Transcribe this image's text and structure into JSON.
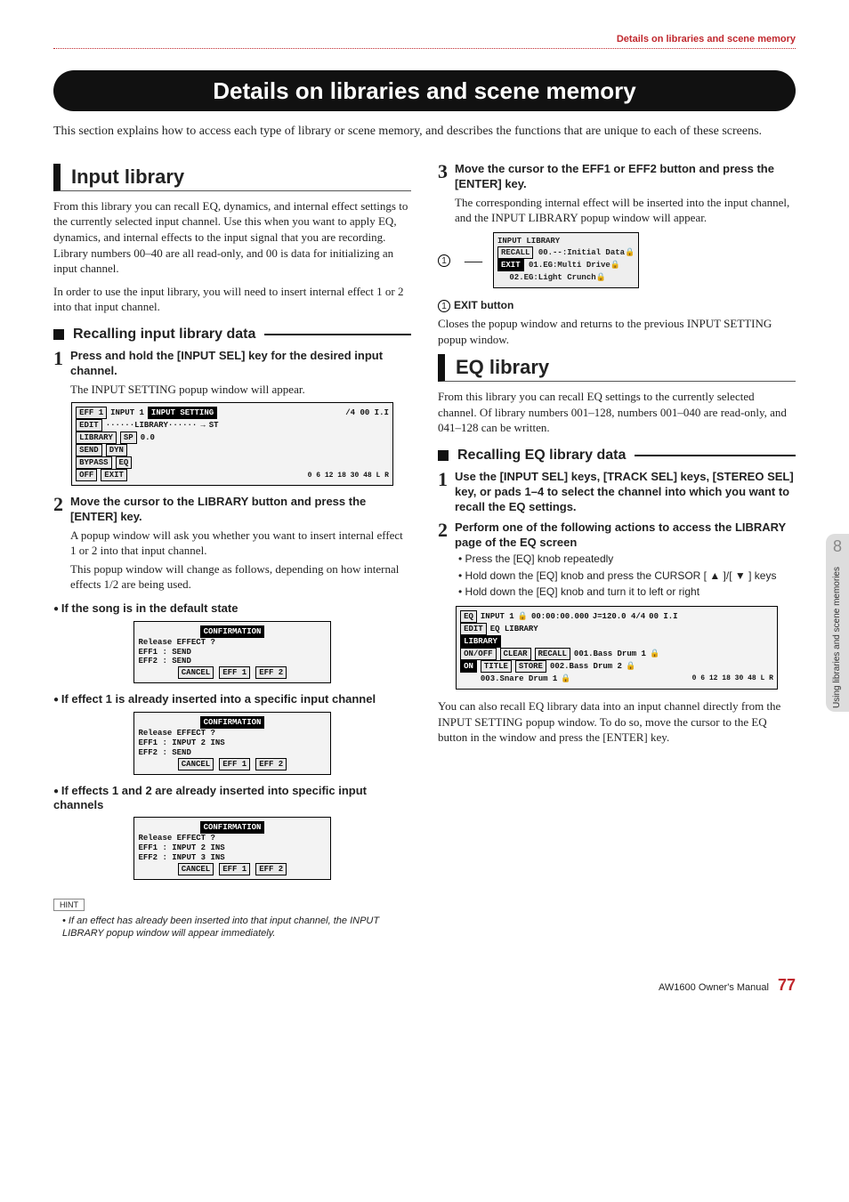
{
  "header_right": "Details on libraries and scene memory",
  "main_title": "Details on libraries and scene memory",
  "intro": "This section explains how to access each type of library or scene memory, and describes the functions that are unique to each of these screens.",
  "side_tab": {
    "chapter": "8",
    "caption": "Using libraries and scene memories"
  },
  "left": {
    "h2": "Input library",
    "p1": "From this library you can recall EQ, dynamics, and internal effect settings to the currently selected input channel. Use this when you want to apply EQ, dynamics, and internal effects to the input signal that you are recording. Library numbers 00–40 are all read-only, and 00 is data for initializing an input channel.",
    "p2": "In order to use the input library, you will need to insert internal effect 1 or 2 into that input channel.",
    "h3": "Recalling input library data",
    "step1_head": "Press and hold the [INPUT SEL] key for the desired input channel.",
    "step1_body": "The INPUT SETTING popup window will appear.",
    "shot1": {
      "eff1": "EFF 1",
      "edit": "EDIT",
      "library": "LIBRARY",
      "send": "SEND",
      "bypass": "BYPASS",
      "off": "OFF",
      "title": "INPUT SETTING",
      "input": "INPUT  1",
      "sp": "SP",
      "dyn": "DYN",
      "eq": "EQ",
      "exit": "EXIT",
      "st": "ST",
      "db": "0.0",
      "meter": "/4 00 I.I",
      "scale": "0 6 12 18 30 48  L R"
    },
    "step2_head": "Move the cursor to the LIBRARY button and press the [ENTER] key.",
    "step2_body1": "A popup window will ask you whether you want to insert internal effect 1 or 2 into that input channel.",
    "step2_body2": "This popup window will change as follows, depending on how internal effects 1/2 are being used.",
    "bt1": "If the song is in the default state",
    "shot2": {
      "title": "CONFIRMATION",
      "q": "Release EFFECT ?",
      "l1": "EFF1 : SEND",
      "l2": "EFF2 : SEND",
      "b1": "CANCEL",
      "b2": "EFF 1",
      "b3": "EFF 2"
    },
    "bt2": "If effect 1 is already inserted into a specific input channel",
    "shot3": {
      "title": "CONFIRMATION",
      "q": "Release EFFECT ?",
      "l1": "EFF1 : INPUT 2 INS",
      "l2": "EFF2 : SEND",
      "b1": "CANCEL",
      "b2": "EFF 1",
      "b3": "EFF 2"
    },
    "bt3": "If effects 1 and 2 are already inserted into specific input channels",
    "shot4": {
      "title": "CONFIRMATION",
      "q": "Release EFFECT ?",
      "l1": "EFF1 : INPUT 2 INS",
      "l2": "EFF2 : INPUT 3 INS",
      "b1": "CANCEL",
      "b2": "EFF 1",
      "b3": "EFF 2"
    },
    "hint_label": "HINT",
    "hint_text": "• If an effect has already been inserted into that input channel, the INPUT LIBRARY popup window will appear immediately."
  },
  "right": {
    "step3_head": "Move the cursor to the EFF1 or EFF2 button and press the [ENTER] key.",
    "step3_body": "The corresponding internal effect will be inserted into the input channel, and the INPUT LIBRARY popup window will appear.",
    "shot5": {
      "title": "INPUT LIBRARY",
      "recall": "RECALL",
      "exit": "EXIT",
      "row0": "00.--:Initial Data",
      "row1": "01.EG:Multi Drive",
      "row2": "02.EG:Light Crunch"
    },
    "callout_num": "1",
    "callout_label": "EXIT button",
    "callout_body": "Closes the popup window and returns to the previous INPUT SETTING popup window.",
    "h2": "EQ library",
    "p1": "From this library you can recall EQ settings to the currently selected channel. Of library numbers 001–128, numbers 001–040 are read-only, and 041–128 can be written.",
    "h3": "Recalling EQ library data",
    "step1_head": "Use the [INPUT SEL] keys, [TRACK SEL] keys, [STEREO SEL] key, or pads 1–4 to select the channel into which you want to recall the EQ settings.",
    "step2_head": "Perform one of the following actions to access the LIBRARY page of the EQ screen",
    "sub1": "Press the [EQ] knob repeatedly",
    "sub2": "Hold down the [EQ] knob and press the CURSOR [ ▲ ]/[ ▼ ] keys",
    "sub3": "Hold down the [EQ] knob and turn it to left or right",
    "shot6": {
      "eq": "EQ",
      "input": "INPUT  1",
      "time": "00:00:00.000",
      "tempo": "J=120.0 4/4",
      "rec": "00 I.I",
      "edit": "EDIT",
      "library": "LIBRARY",
      "onoff": "ON/OFF",
      "on": "ON",
      "caption": "EQ LIBRARY",
      "clear": "CLEAR",
      "recall": "RECALL",
      "titlebtn": "TITLE",
      "store": "STORE",
      "row1": "001.Bass Drum 1",
      "row2": "002.Bass Drum 2",
      "row3": "003.Snare Drum 1",
      "scale": "0 6 12 18 30 48  L R"
    },
    "p2": "You can also recall EQ library data into an input channel directly from the INPUT SETTING popup window. To do so, move the cursor to the EQ button in the window and press the [ENTER] key."
  },
  "footer": {
    "manual": "AW1600  Owner's Manual",
    "page": "77"
  }
}
